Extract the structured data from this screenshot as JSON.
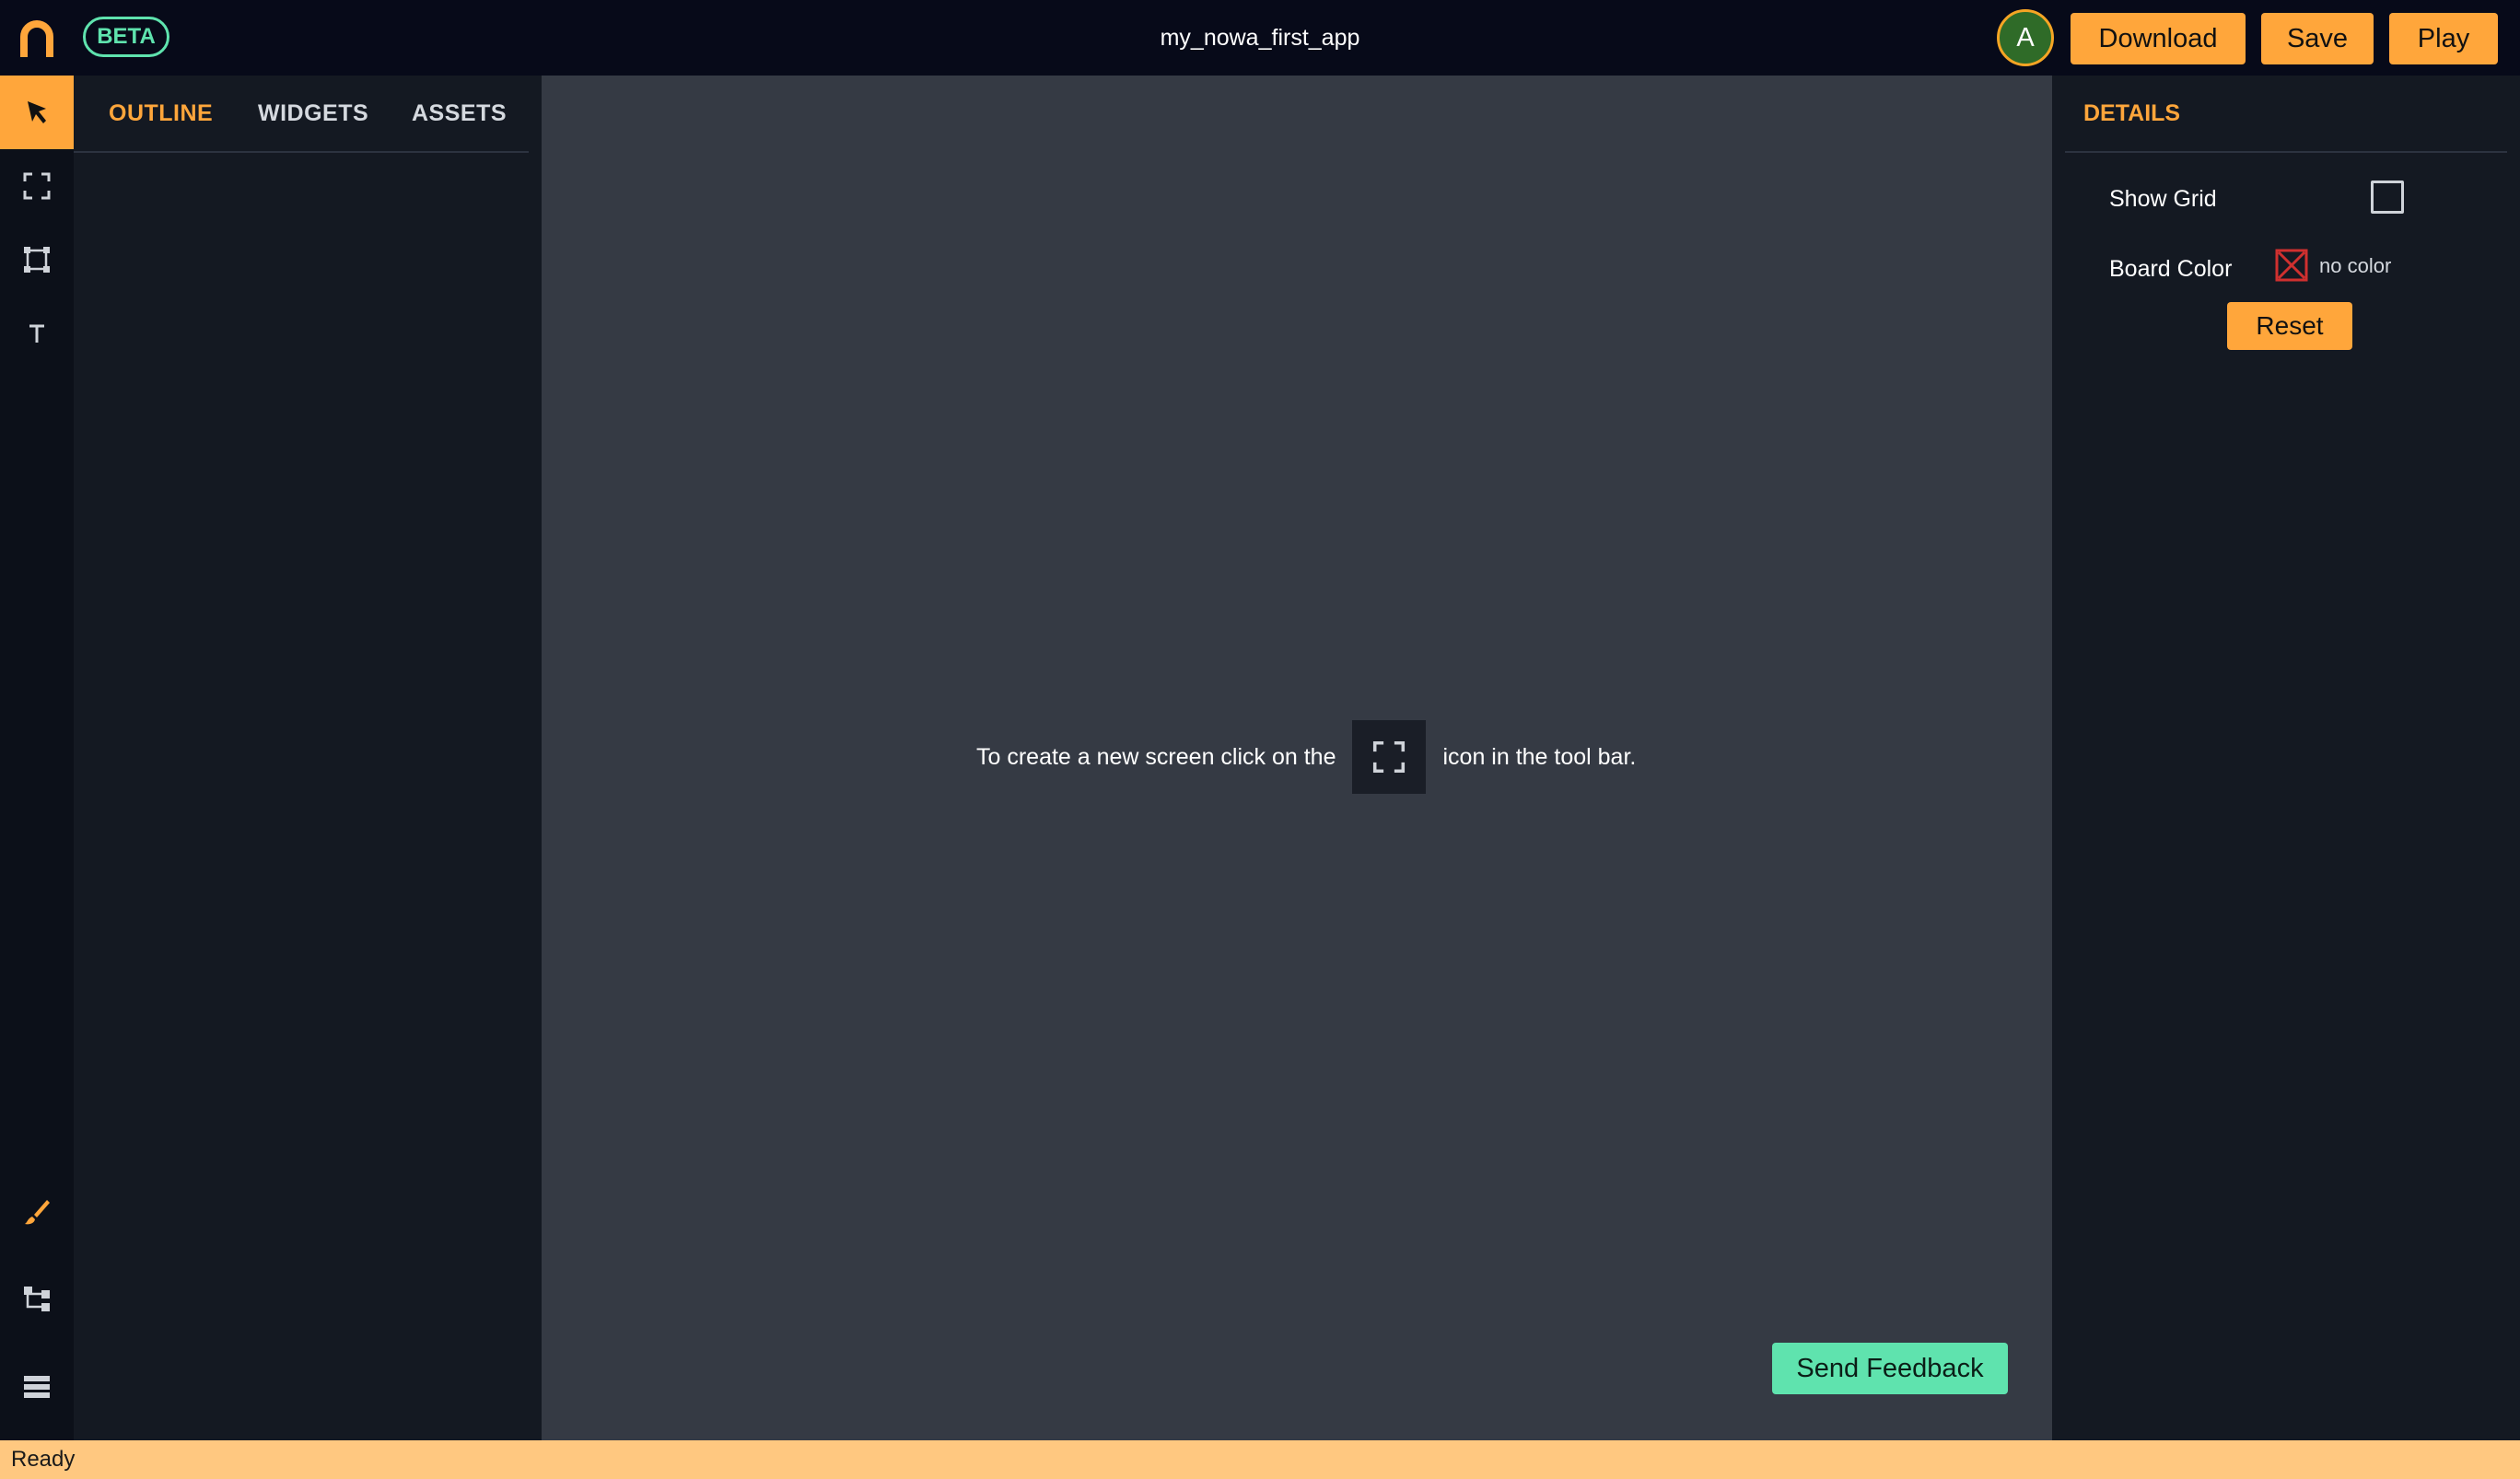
{
  "header": {
    "beta_label": "BETA",
    "app_title": "my_nowa_first_app",
    "avatar_initial": "A",
    "download_label": "Download",
    "save_label": "Save",
    "play_label": "Play"
  },
  "toolbar": {
    "tools": [
      "select-tool",
      "screen-tool",
      "frame-tool",
      "text-tool"
    ],
    "bottom_tools": [
      "theme-tool",
      "tree-tool",
      "data-tool"
    ]
  },
  "left_panel": {
    "tabs": [
      {
        "label": "OUTLINE",
        "active": true
      },
      {
        "label": "WIDGETS",
        "active": false
      },
      {
        "label": "ASSETS",
        "active": false
      }
    ]
  },
  "canvas": {
    "hint_before": "To create a new screen click on the",
    "hint_after": "icon in the tool bar.",
    "feedback_label": "Send Feedback"
  },
  "details": {
    "title": "DETAILS",
    "show_grid_label": "Show Grid",
    "show_grid_checked": false,
    "board_color_label": "Board Color",
    "board_color_value": "no color",
    "reset_label": "Reset"
  },
  "status": {
    "text": "Ready"
  },
  "colors": {
    "accent": "#ffa63b",
    "green": "#5fe3ae",
    "canvas": "#353a44",
    "panel": "#141922",
    "status": "#ffc880"
  }
}
